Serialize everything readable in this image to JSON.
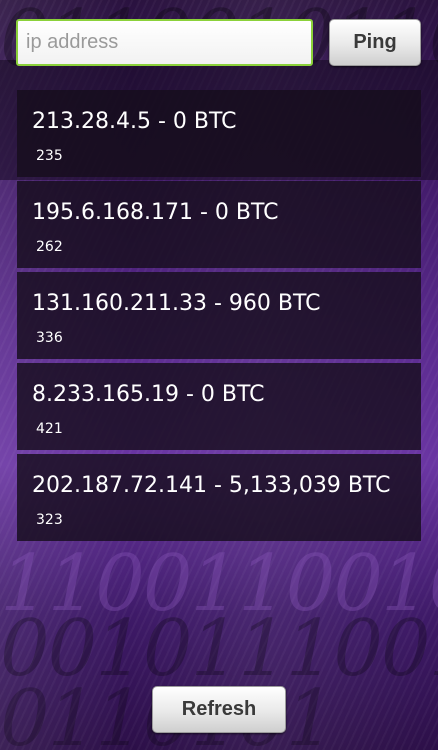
{
  "search": {
    "placeholder": "ip address",
    "value": ""
  },
  "buttons": {
    "ping": "Ping",
    "refresh": "Refresh"
  },
  "results": [
    {
      "ip": "213.28.4.5",
      "btc": "0 BTC",
      "title": "213.28.4.5 - 0 BTC",
      "latency": "235"
    },
    {
      "ip": "195.6.168.171",
      "btc": "0 BTC",
      "title": "195.6.168.171 - 0 BTC",
      "latency": "262"
    },
    {
      "ip": "131.160.211.33",
      "btc": "960 BTC",
      "title": "131.160.211.33 - 960 BTC",
      "latency": "336"
    },
    {
      "ip": "8.233.165.19",
      "btc": "0 BTC",
      "title": "8.233.165.19 - 0 BTC",
      "latency": "421"
    },
    {
      "ip": "202.187.72.141",
      "btc": "5,133,039 BTC",
      "title": "202.187.72.141 - 5,133,039 BTC",
      "latency": "323"
    }
  ],
  "colors": {
    "input_border": "#8bd13a",
    "background_accent": "#5a2a8e",
    "row_background": "#160e1c"
  }
}
